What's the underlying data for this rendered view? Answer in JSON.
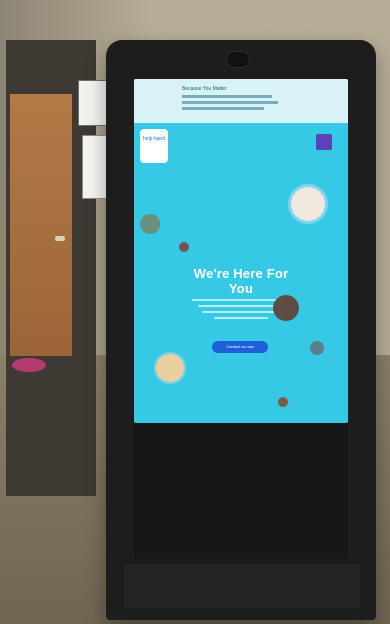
{
  "screen": {
    "banner_title": "Because You Matter",
    "logo_text": "help hand",
    "headline": "We're Here For You",
    "cta": "Contact us now"
  },
  "colors": {
    "wall": "#b7ae97",
    "floor": "#7d725d",
    "door": "#a46d3d",
    "kiosk": "#1d1d1d",
    "screen": "#36c9e6",
    "cta": "#1d60d9"
  }
}
